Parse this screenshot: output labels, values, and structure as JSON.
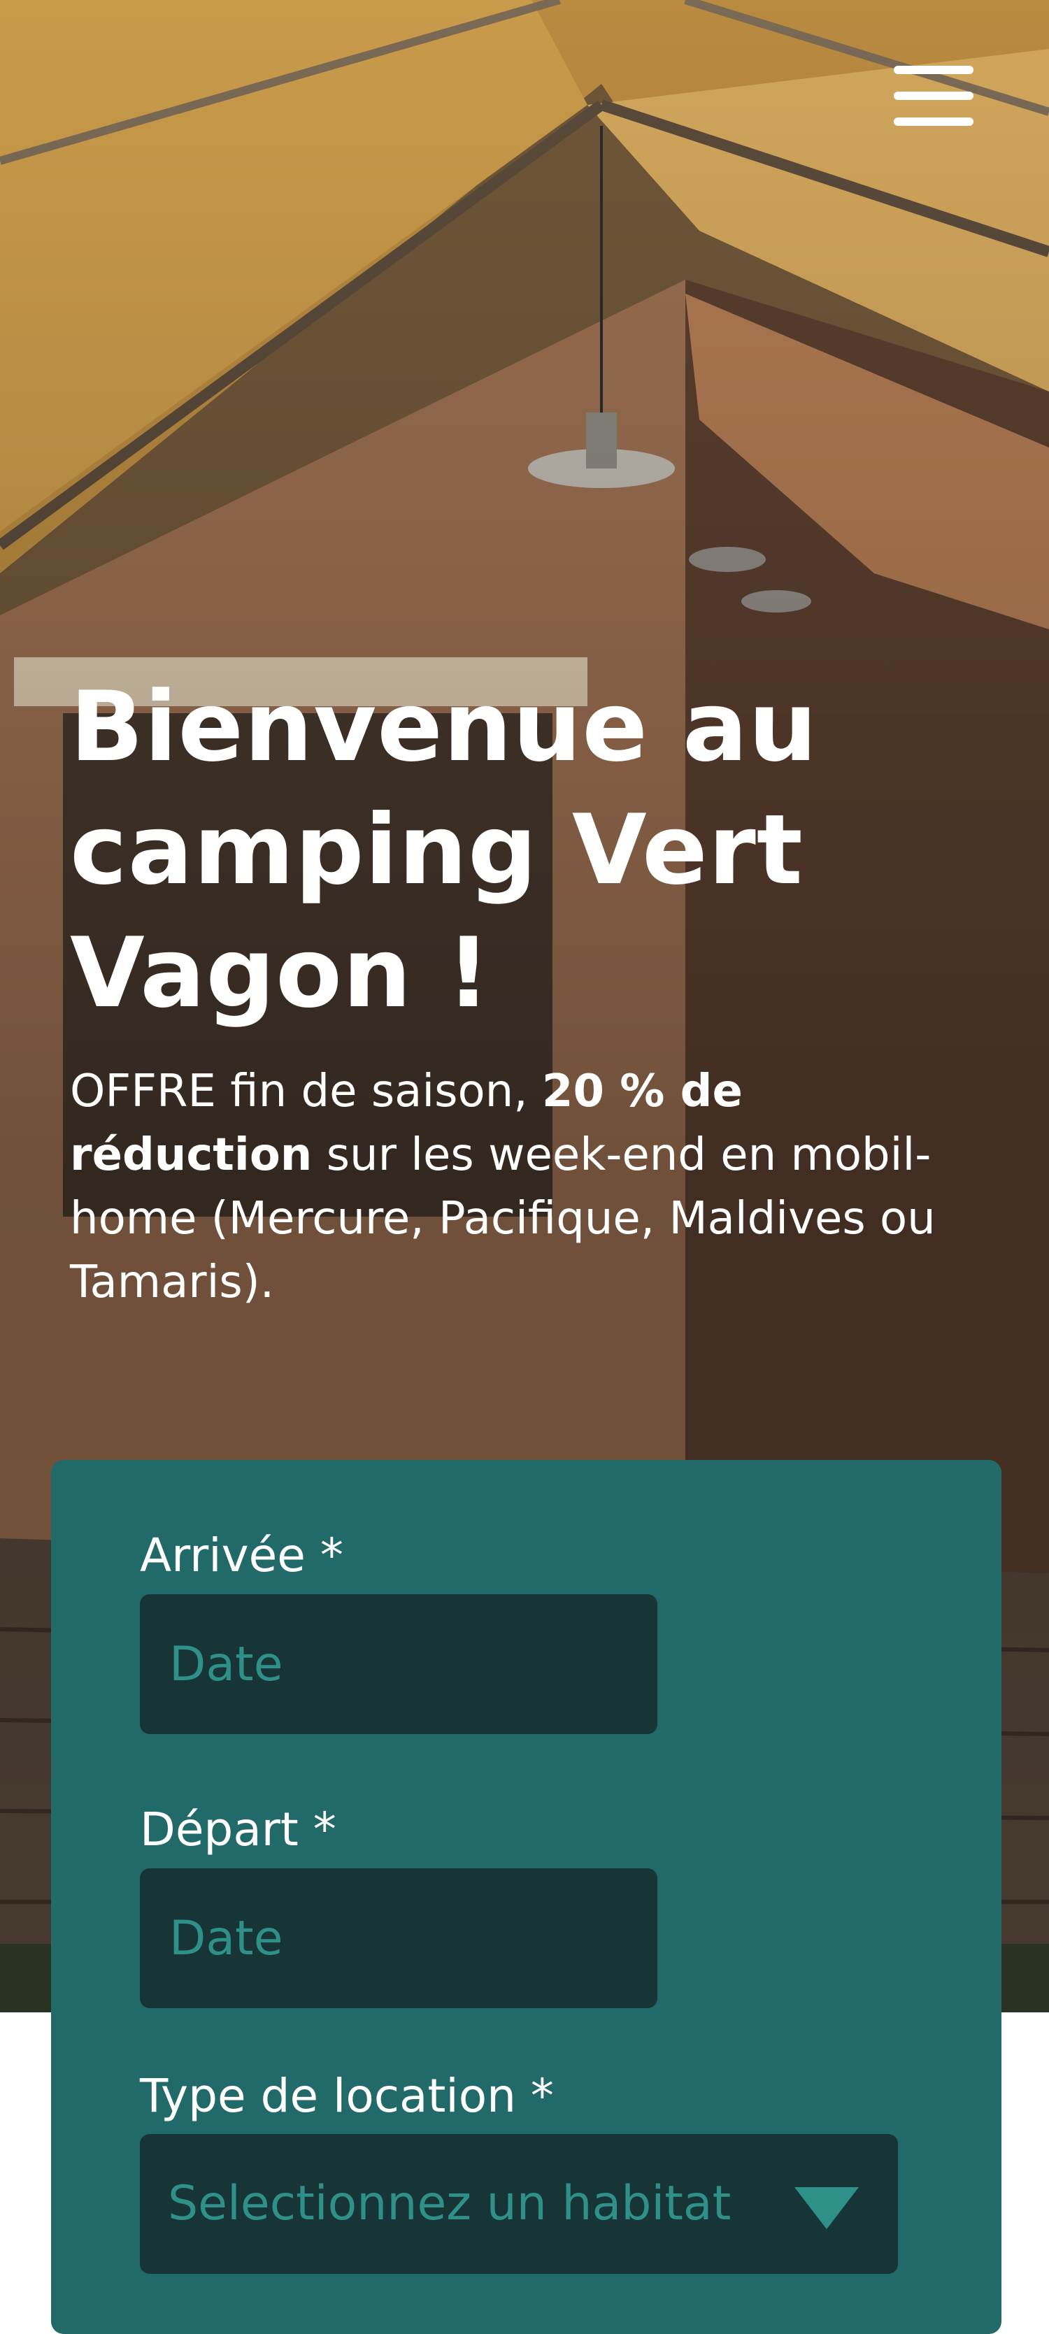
{
  "header": {
    "menu_icon": "hamburger-menu-icon"
  },
  "hero": {
    "background": "tent-interior-photo",
    "title": "Bienvenue au camping Vert Vagon !",
    "offer": {
      "prefix": "OFFRE fin de saison, ",
      "highlight_1": "20 % de",
      "highlight_2": "réduction",
      "suffix": " sur les week-end en mobil-home (Mercure, Pacifique, Maldives ou Tamaris)."
    }
  },
  "booking_form": {
    "arrival": {
      "label": "Arrivée *",
      "placeholder": "Date"
    },
    "departure": {
      "label": "Départ *",
      "placeholder": "Date"
    },
    "rental_type": {
      "label": "Type de location *",
      "selected": "Selectionnez un habitat",
      "arrow_icon": "triangle-down-icon"
    }
  },
  "colors": {
    "card_background": "#226a69",
    "input_background": "#173536",
    "input_text": "#2f8f89",
    "text_light": "#ffffff"
  }
}
